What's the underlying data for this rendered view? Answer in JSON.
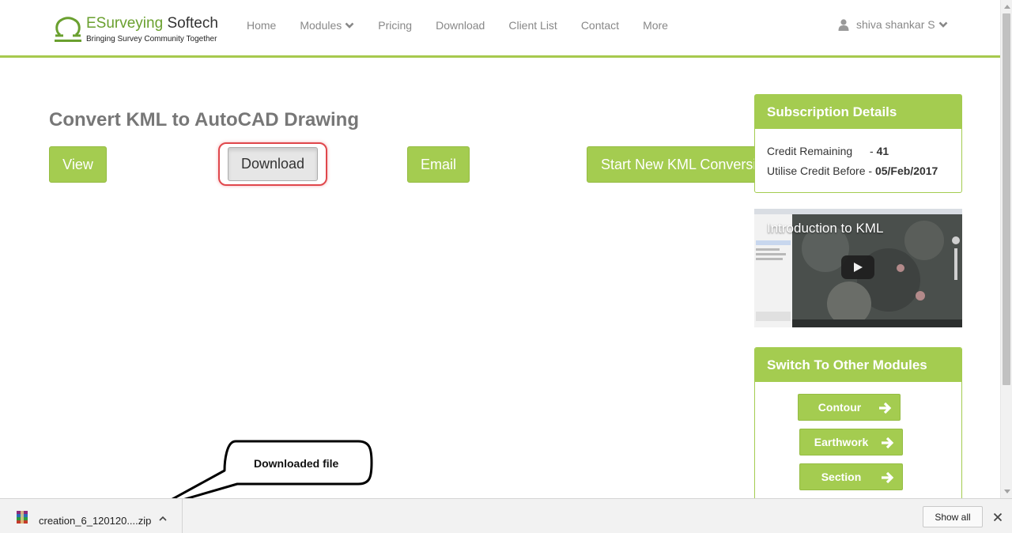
{
  "header": {
    "brand_part1": "ESurveying",
    "brand_part2": " Softech",
    "tagline": "Bringing Survey Community Together",
    "nav": [
      {
        "label": "Home"
      },
      {
        "label": "Modules",
        "has_dropdown": true
      },
      {
        "label": "Pricing"
      },
      {
        "label": "Download"
      },
      {
        "label": "Client List"
      },
      {
        "label": "Contact"
      },
      {
        "label": "More"
      }
    ],
    "user_name": "shiva shankar S"
  },
  "main": {
    "title": "Convert KML to AutoCAD Drawing",
    "buttons": {
      "view": "View",
      "download": "Download",
      "email": "Email",
      "new_conversion": "Start New KML Conversion"
    }
  },
  "sidebar": {
    "subscription": {
      "title": "Subscription Details",
      "credit_label": "Credit Remaining",
      "credit_sep": "- ",
      "credit_value": "41",
      "expiry_label": "Utilise Credit Before",
      "expiry_sep": " - ",
      "expiry_value": "05/Feb/2017"
    },
    "video": {
      "title": "Introduction to KML"
    },
    "modules": {
      "title": "Switch To Other Modules",
      "items": [
        {
          "label": "Contour"
        },
        {
          "label": "Earthwork"
        },
        {
          "label": "Section"
        }
      ]
    }
  },
  "callout": {
    "text": "Downloaded file"
  },
  "download_bar": {
    "file_name": "creation_6_120120....zip",
    "show_all": "Show all"
  },
  "colors": {
    "accent_green": "#a4cc50",
    "brand_green": "#6aa02f",
    "highlight_red": "#e0474c"
  }
}
